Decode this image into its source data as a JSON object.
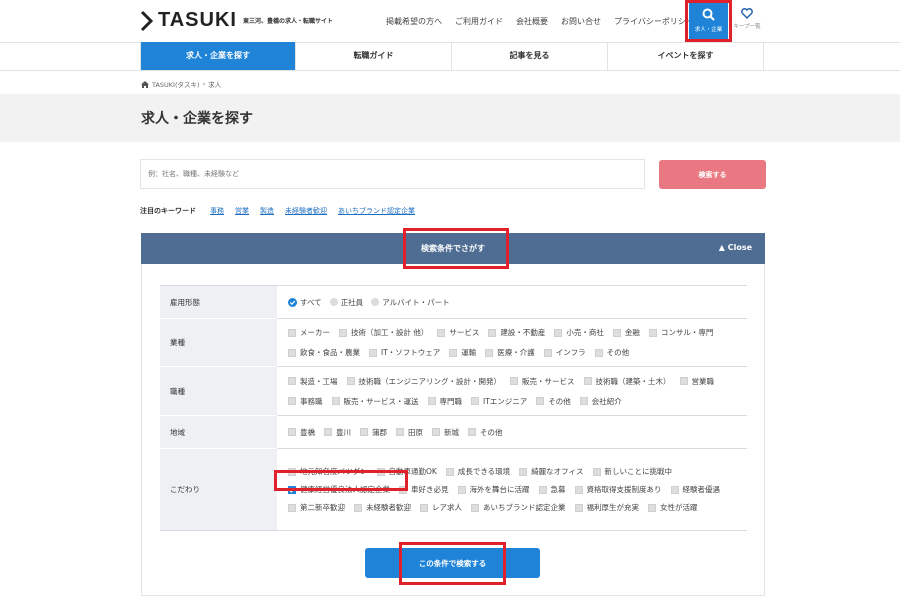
{
  "header": {
    "logo": "TASUKI",
    "tagline": "東三河、豊橋の求人・転職サイト",
    "nav": [
      "掲載希望の方へ",
      "ご利用ガイド",
      "会社概要",
      "お問い合せ",
      "プライバシーポリシー"
    ],
    "search_label": "求人・企業",
    "favorites_label": "キープ一覧"
  },
  "tabs": [
    "求人・企業を探す",
    "転職ガイド",
    "記事を見る",
    "イベントを探す"
  ],
  "breadcrumb": {
    "home": "TASUKI(タスキ)",
    "separator": "›",
    "current": "求人"
  },
  "page_title": "求人・企業を探す",
  "search": {
    "placeholder": "例：社名、職種、未経験など",
    "button": "検索する"
  },
  "keywords": {
    "label": "注目のキーワード",
    "items": [
      "事務",
      "営業",
      "製造",
      "未経験者歓迎",
      "あいちブランド認定企業"
    ]
  },
  "panel": {
    "title": "検索条件でさがす",
    "close": "Close"
  },
  "conditions": {
    "employment": {
      "label": "雇用形態",
      "options": [
        "すべて",
        "正社員",
        "アルバイト・パート"
      ],
      "selected": "すべて"
    },
    "industry": {
      "label": "業種",
      "options": [
        "メーカー",
        "技術（加工・設計 他）",
        "サービス",
        "建設・不動産",
        "小売・商社",
        "金融",
        "コンサル・専門",
        "飲食・食品・農業",
        "IT・ソフトウェア",
        "運輸",
        "医療・介護",
        "インフラ",
        "その他"
      ]
    },
    "job": {
      "label": "職種",
      "options": [
        "製造・工場",
        "技術職（エンジニアリング・設計・開発）",
        "販売・サービス",
        "技術職（建築・土木）",
        "営業職",
        "事務職",
        "販売・サービス・運送",
        "専門職",
        "ITエンジニア",
        "その他",
        "会社紹介"
      ]
    },
    "area": {
      "label": "地域",
      "options": [
        "豊橋",
        "豊川",
        "蒲郡",
        "田原",
        "新城",
        "その他"
      ]
    },
    "features": {
      "label": "こだわり",
      "options": [
        "地元知名度バツグン",
        "自動車通勤OK",
        "成長できる環境",
        "綺麗なオフィス",
        "新しいことに挑戦中",
        "健康経営優良法人認定企業",
        "車好き必見",
        "海外を舞台に活躍",
        "急募",
        "資格取得支援制度あり",
        "経験者優遇",
        "第二新卒歓迎",
        "未経験者歓迎",
        "レア求人",
        "あいちブランド認定企業",
        "福利厚生が充実",
        "女性が活躍"
      ],
      "checked": [
        "健康経営優良法人認定企業"
      ]
    }
  },
  "submit": "この条件で検索する",
  "colors": {
    "primary": "#1f83d8",
    "panel_header": "#4f6d93",
    "search_button": "#e97882",
    "highlight": "#e0202a"
  }
}
